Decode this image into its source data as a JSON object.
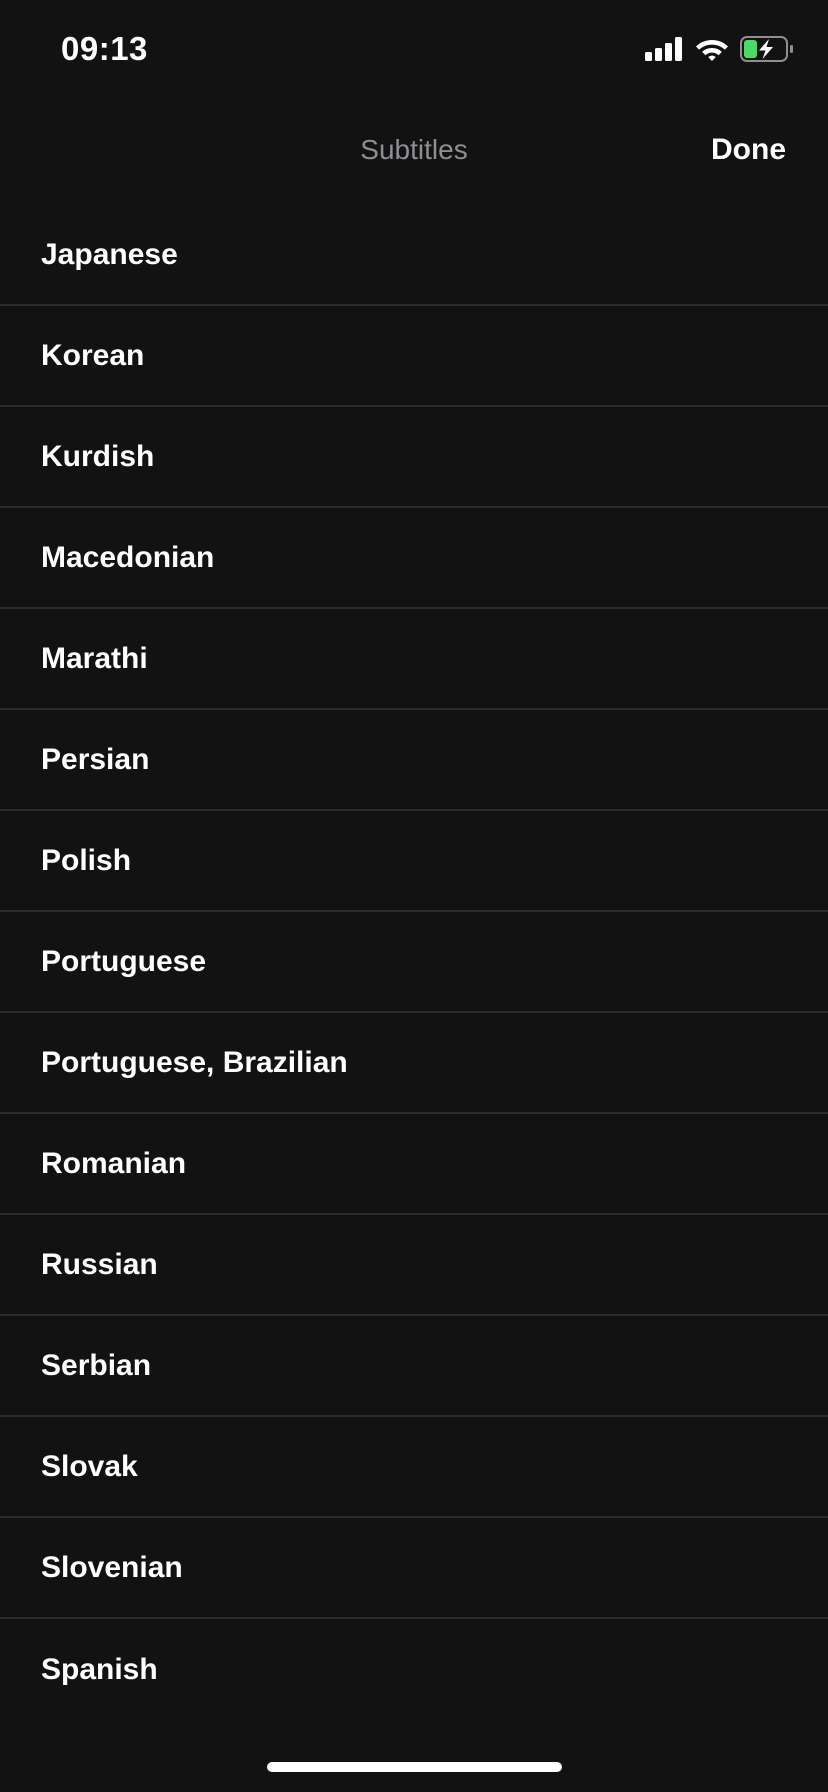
{
  "status_bar": {
    "time": "09:13",
    "icons": [
      "cellular-signal-icon",
      "wifi-icon",
      "battery-charging-icon"
    ],
    "battery_color": "#4cd964"
  },
  "nav": {
    "title": "Subtitles",
    "done_label": "Done"
  },
  "languages": [
    "Japanese",
    "Korean",
    "Kurdish",
    "Macedonian",
    "Marathi",
    "Persian",
    "Polish",
    "Portuguese",
    "Portuguese, Brazilian",
    "Romanian",
    "Russian",
    "Serbian",
    "Slovak",
    "Slovenian",
    "Spanish"
  ],
  "colors": {
    "background": "#121212",
    "separator": "#2c2c2e",
    "title": "#8e8e93",
    "text": "#ffffff"
  }
}
